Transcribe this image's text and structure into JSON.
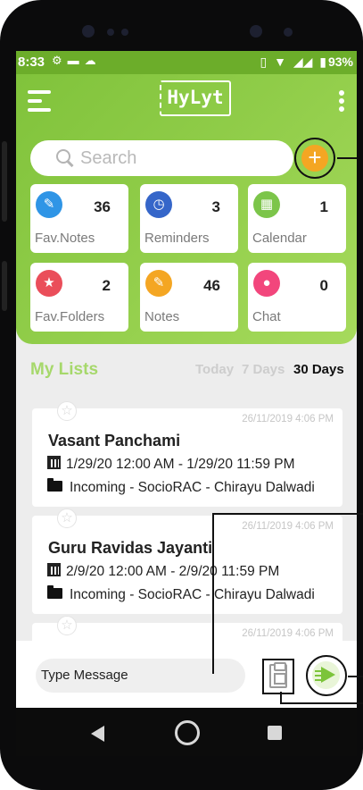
{
  "status": {
    "time": "8:33",
    "battery": "93%"
  },
  "header": {
    "logo": "HyLyt"
  },
  "search": {
    "placeholder": "Search"
  },
  "tiles": [
    {
      "label": "Fav.Notes",
      "count": "36",
      "color": "#2f95e6",
      "icon": "note-star-icon"
    },
    {
      "label": "Reminders",
      "count": "3",
      "color": "#3566c9",
      "icon": "clock-icon"
    },
    {
      "label": "Calendar",
      "count": "1",
      "color": "#7cc54a",
      "icon": "calendar-icon"
    },
    {
      "label": "Fav.Folders",
      "count": "2",
      "color": "#ea4e5a",
      "icon": "folder-star-icon"
    },
    {
      "label": "Notes",
      "count": "46",
      "color": "#f4a623",
      "icon": "note-icon"
    },
    {
      "label": "Chat",
      "count": "0",
      "color": "#f2467c",
      "icon": "chat-bubble-icon"
    }
  ],
  "lists": {
    "title": "My Lists",
    "filters": [
      "Today",
      "7 Days",
      "30 Days"
    ],
    "active_filter": "30 Days",
    "items": [
      {
        "date": "26/11/2019 4:06 PM",
        "title": "Vasant Panchami",
        "time": "1/29/20 12:00 AM - 1/29/20 11:59 PM",
        "source": "Incoming - SocioRAC - Chirayu Dalwadi"
      },
      {
        "date": "26/11/2019 4:06 PM",
        "title": "Guru Ravidas Jayanti",
        "time": "2/9/20 12:00 AM - 2/9/20 11:59 PM",
        "source": "Incoming - SocioRAC - Chirayu Dalwadi"
      },
      {
        "date": "26/11/2019 4:06 PM"
      }
    ]
  },
  "compose": {
    "placeholder": "Type Message"
  },
  "colors": {
    "brand_green": "#8fcc48",
    "accent_orange": "#f4a623"
  }
}
